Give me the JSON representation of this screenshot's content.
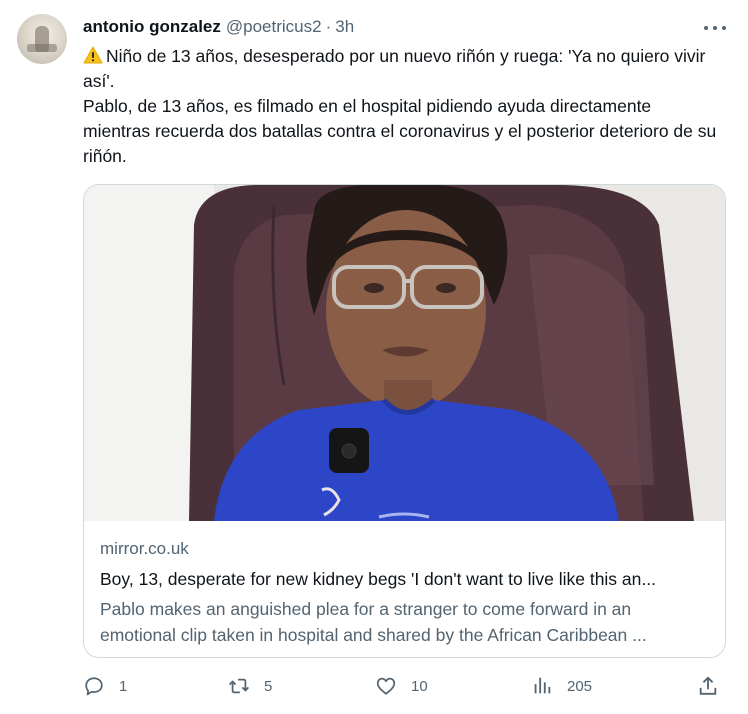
{
  "author": {
    "name": "antonio gonzalez",
    "handle": "@poetricus2",
    "separator": "·",
    "time": "3h"
  },
  "tweet": {
    "line1": "Niño de 13 años, desesperado por un nuevo riñón y ruega: 'Ya no quiero vivir así'.",
    "line2": "Pablo, de 13 años, es filmado en el hospital pidiendo ayuda directamente mientras recuerda dos batallas contra el coronavirus y el posterior deterioro de su riñón.",
    "lead_icon": "warning-emoji"
  },
  "card": {
    "domain": "mirror.co.uk",
    "title": "Boy, 13, desperate for new kidney begs 'I don't want to live like this an...",
    "description": "Pablo makes an anguished plea for a stranger to come forward in an emotional clip taken in hospital and shared by the African Caribbean ..."
  },
  "actions": {
    "replies": "1",
    "retweets": "5",
    "likes": "10",
    "views": "205"
  },
  "icons": {
    "more": "more-horizontal-icon",
    "reply": "reply-icon",
    "retweet": "retweet-icon",
    "like": "heart-icon",
    "views": "analytics-icon",
    "share": "share-icon"
  },
  "colors": {
    "text": "#0f1419",
    "secondary": "#536471",
    "border": "#cfd9de"
  }
}
